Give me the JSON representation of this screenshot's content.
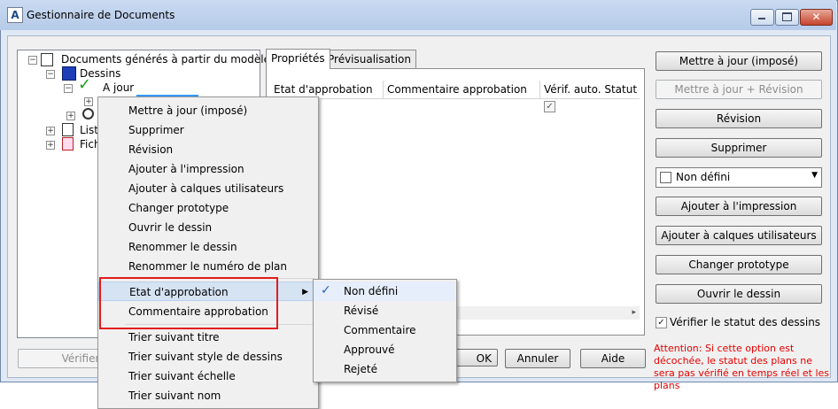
{
  "window": {
    "title": "Gestionnaire de Documents",
    "app_icon": "A"
  },
  "tree": {
    "root": "Documents générés à partir du modèle",
    "items": [
      {
        "label": "Dessins"
      },
      {
        "label": "A jour"
      },
      {
        "label": "Liste"
      },
      {
        "label": "Fich"
      }
    ]
  },
  "tabs": [
    {
      "label": "Propriétés"
    },
    {
      "label": "Prévisualisation"
    }
  ],
  "grid": {
    "columns": [
      "Etat d'approbation",
      "Commentaire approbation",
      "Vérif. auto. Statut"
    ],
    "checkbox_mark": "✓"
  },
  "right_buttons": {
    "update_forced": "Mettre à jour (imposé)",
    "update_revision": "Mettre à jour + Révision",
    "revision": "Révision",
    "delete": "Supprimer",
    "combo_value": "Non défini",
    "add_print": "Ajouter à l'impression",
    "add_layers": "Ajouter à calques utilisateurs",
    "change_proto": "Changer prototype",
    "open_drawing": "Ouvrir le dessin",
    "verify_label": "Vérifier le statut des dessins",
    "attention": "Attention: Si cette option est décochée, le statut des plans ne sera pas vérifié en temps réel et les plans"
  },
  "bottom_buttons": {
    "verify": "Vérifier",
    "ok": "OK",
    "cancel": "Annuler",
    "help": "Aide"
  },
  "context_menu": {
    "items": [
      "Mettre à jour (imposé)",
      "Supprimer",
      "Révision",
      "Ajouter à l'impression",
      "Ajouter à calques utilisateurs",
      "Changer prototype",
      "Ouvrir le dessin",
      "Renommer le dessin",
      "Renommer le numéro de plan"
    ],
    "approval": "Etat d'approbation",
    "comment": "Commentaire approbation",
    "sort_items": [
      "Trier suivant titre",
      "Trier suivant style de dessins",
      "Trier suivant échelle",
      "Trier suivant nom"
    ]
  },
  "submenu": {
    "items": [
      "Non défini",
      "Révisé",
      "Commentaire",
      "Approuvé",
      "Rejeté"
    ],
    "check": "✓"
  },
  "colors": {
    "highlight_box": "#e21c1c",
    "attention_text": "#e60000",
    "check_green": "#1b9e1b"
  }
}
